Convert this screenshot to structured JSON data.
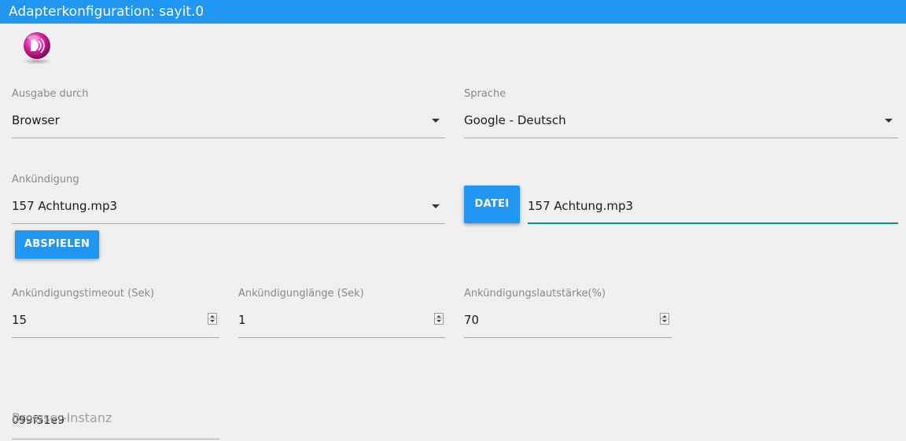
{
  "window": {
    "title": "Adapterkonfiguration: sayit.0"
  },
  "icons": {
    "logo": "sayit-speaker-logo-icon",
    "dropdown": "caret-down-icon",
    "spinner": "number-spinner-icon"
  },
  "colors": {
    "accent": "#2196f3",
    "focus_underline": "#009688",
    "logo_magenta": "#d6209b"
  },
  "form": {
    "output": {
      "label": "Ausgabe durch",
      "value": "Browser"
    },
    "language": {
      "label": "Sprache",
      "value": "Google - Deutsch"
    },
    "announce": {
      "label": "Ankündigung",
      "value": "157 Achtung.mp3"
    },
    "file_button": "DATEI",
    "file_value": "157 Achtung.mp3",
    "play_button": "ABSPIELEN",
    "announce_timeout": {
      "label": "Ankündigungstimeout (Sek)",
      "value": "15"
    },
    "announce_length": {
      "label": "Ankündigunglänge (Sek)",
      "value": "1"
    },
    "announce_volume": {
      "label": "Ankündigungslautstärke(%)",
      "value": "70"
    },
    "browser_instance": {
      "label": "Browser-Instanz",
      "value": "099f51e9"
    }
  }
}
